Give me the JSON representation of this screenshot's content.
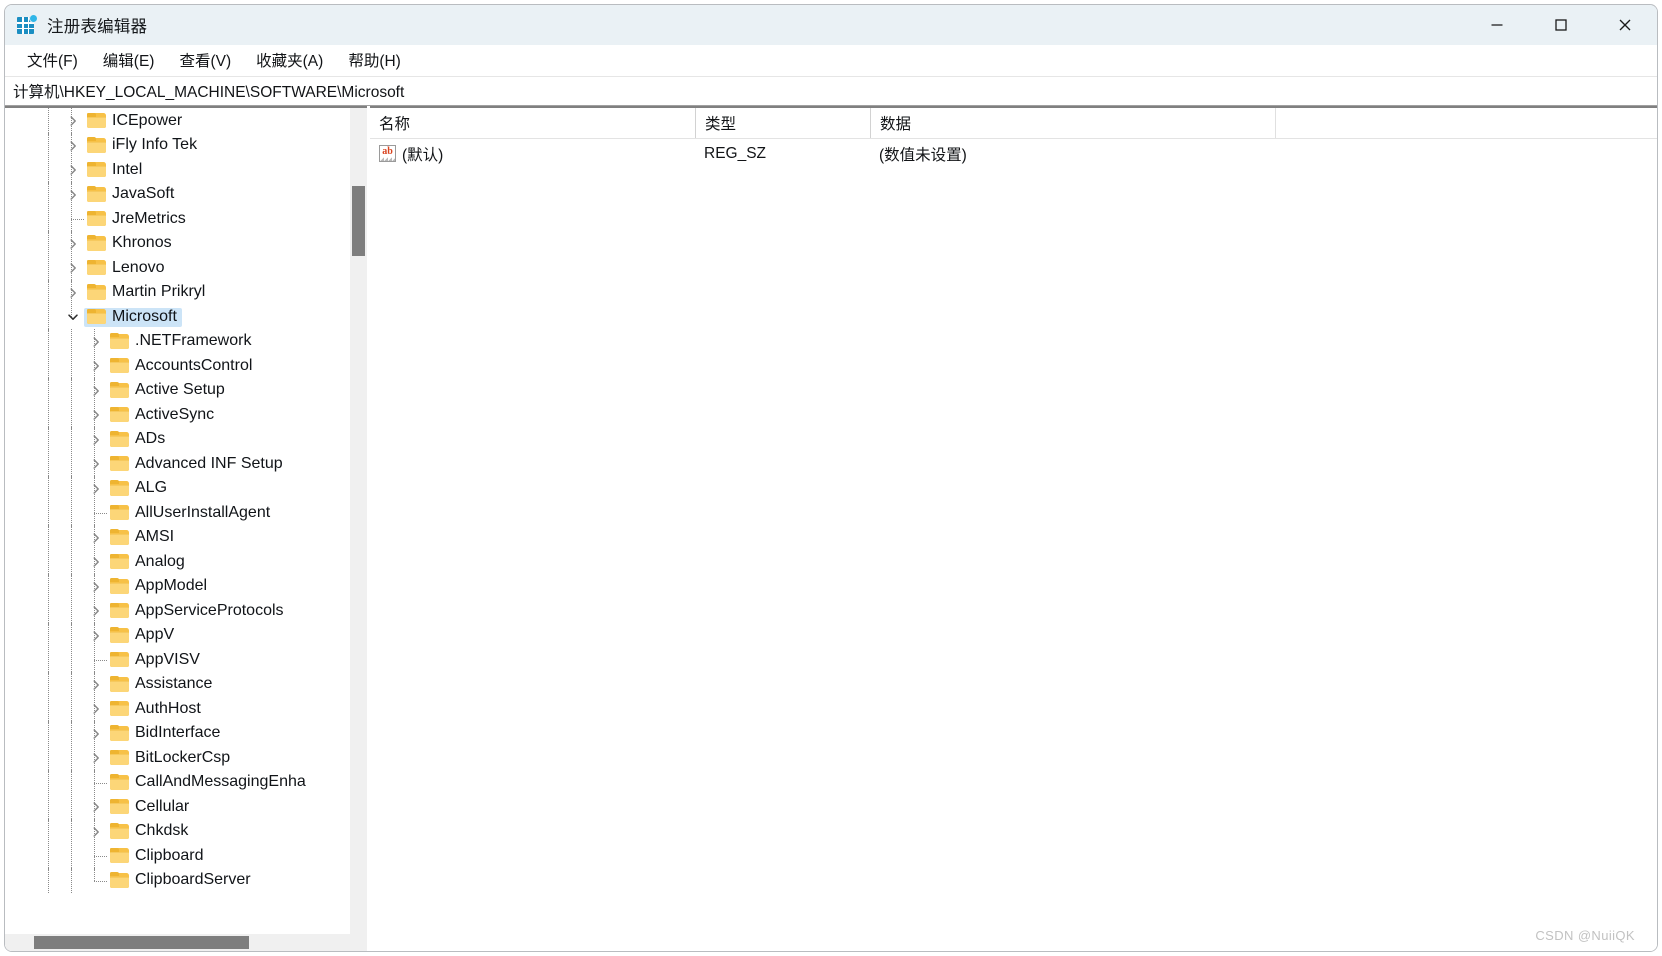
{
  "window": {
    "title": "注册表编辑器",
    "app_icon": "registry-editor-icon",
    "controls": {
      "minimize": "最小化",
      "maximize": "最大化",
      "close": "关闭"
    }
  },
  "menubar": {
    "items": [
      {
        "label": "文件(F)",
        "text": "文件",
        "accel": "F"
      },
      {
        "label": "编辑(E)",
        "text": "编辑",
        "accel": "E"
      },
      {
        "label": "查看(V)",
        "text": "查看",
        "accel": "V"
      },
      {
        "label": "收藏夹(A)",
        "text": "收藏夹",
        "accel": "A"
      },
      {
        "label": "帮助(H)",
        "text": "帮助",
        "accel": "H"
      }
    ]
  },
  "address": {
    "path": "计算机\\HKEY_LOCAL_MACHINE\\SOFTWARE\\Microsoft"
  },
  "tree": {
    "selected": "Microsoft",
    "nodes": [
      {
        "label": "ICEpower",
        "depth": 2,
        "expandable": true,
        "expanded": false,
        "selected": false
      },
      {
        "label": "iFly Info Tek",
        "depth": 2,
        "expandable": true,
        "expanded": false,
        "selected": false
      },
      {
        "label": "Intel",
        "depth": 2,
        "expandable": true,
        "expanded": false,
        "selected": false
      },
      {
        "label": "JavaSoft",
        "depth": 2,
        "expandable": true,
        "expanded": false,
        "selected": false
      },
      {
        "label": "JreMetrics",
        "depth": 2,
        "expandable": false,
        "expanded": false,
        "selected": false
      },
      {
        "label": "Khronos",
        "depth": 2,
        "expandable": true,
        "expanded": false,
        "selected": false
      },
      {
        "label": "Lenovo",
        "depth": 2,
        "expandable": true,
        "expanded": false,
        "selected": false
      },
      {
        "label": "Martin Prikryl",
        "depth": 2,
        "expandable": true,
        "expanded": false,
        "selected": false
      },
      {
        "label": "Microsoft",
        "depth": 2,
        "expandable": true,
        "expanded": true,
        "selected": true
      },
      {
        "label": ".NETFramework",
        "depth": 3,
        "expandable": true,
        "expanded": false,
        "selected": false
      },
      {
        "label": "AccountsControl",
        "depth": 3,
        "expandable": true,
        "expanded": false,
        "selected": false
      },
      {
        "label": "Active Setup",
        "depth": 3,
        "expandable": true,
        "expanded": false,
        "selected": false
      },
      {
        "label": "ActiveSync",
        "depth": 3,
        "expandable": true,
        "expanded": false,
        "selected": false
      },
      {
        "label": "ADs",
        "depth": 3,
        "expandable": true,
        "expanded": false,
        "selected": false
      },
      {
        "label": "Advanced INF Setup",
        "depth": 3,
        "expandable": true,
        "expanded": false,
        "selected": false
      },
      {
        "label": "ALG",
        "depth": 3,
        "expandable": true,
        "expanded": false,
        "selected": false
      },
      {
        "label": "AllUserInstallAgent",
        "depth": 3,
        "expandable": false,
        "expanded": false,
        "selected": false
      },
      {
        "label": "AMSI",
        "depth": 3,
        "expandable": true,
        "expanded": false,
        "selected": false
      },
      {
        "label": "Analog",
        "depth": 3,
        "expandable": true,
        "expanded": false,
        "selected": false
      },
      {
        "label": "AppModel",
        "depth": 3,
        "expandable": true,
        "expanded": false,
        "selected": false
      },
      {
        "label": "AppServiceProtocols",
        "depth": 3,
        "expandable": true,
        "expanded": false,
        "selected": false
      },
      {
        "label": "AppV",
        "depth": 3,
        "expandable": true,
        "expanded": false,
        "selected": false
      },
      {
        "label": "AppVISV",
        "depth": 3,
        "expandable": false,
        "expanded": false,
        "selected": false
      },
      {
        "label": "Assistance",
        "depth": 3,
        "expandable": true,
        "expanded": false,
        "selected": false
      },
      {
        "label": "AuthHost",
        "depth": 3,
        "expandable": true,
        "expanded": false,
        "selected": false
      },
      {
        "label": "BidInterface",
        "depth": 3,
        "expandable": true,
        "expanded": false,
        "selected": false
      },
      {
        "label": "BitLockerCsp",
        "depth": 3,
        "expandable": true,
        "expanded": false,
        "selected": false
      },
      {
        "label": "CallAndMessagingEnha",
        "depth": 3,
        "expandable": false,
        "expanded": false,
        "selected": false
      },
      {
        "label": "Cellular",
        "depth": 3,
        "expandable": true,
        "expanded": false,
        "selected": false
      },
      {
        "label": "Chkdsk",
        "depth": 3,
        "expandable": true,
        "expanded": false,
        "selected": false
      },
      {
        "label": "Clipboard",
        "depth": 3,
        "expandable": false,
        "expanded": false,
        "selected": false
      },
      {
        "label": "ClipboardServer",
        "depth": 3,
        "expandable": false,
        "expanded": false,
        "selected": false
      }
    ]
  },
  "values": {
    "columns": [
      {
        "key": "name",
        "label": "名称"
      },
      {
        "key": "type",
        "label": "类型"
      },
      {
        "key": "data",
        "label": "数据"
      }
    ],
    "rows": [
      {
        "icon": "string-value-icon",
        "name": "(默认)",
        "type": "REG_SZ",
        "data": "(数值未设置)"
      }
    ]
  },
  "watermark": {
    "text": "CSDN @NuiiQK"
  },
  "colors": {
    "titlebar": "#eaf1f5",
    "selection": "#cce4f7",
    "folder": "#f7c147",
    "scrollbar_thumb": "#7e7e7e",
    "accent_icon": "#1b8ec2"
  }
}
